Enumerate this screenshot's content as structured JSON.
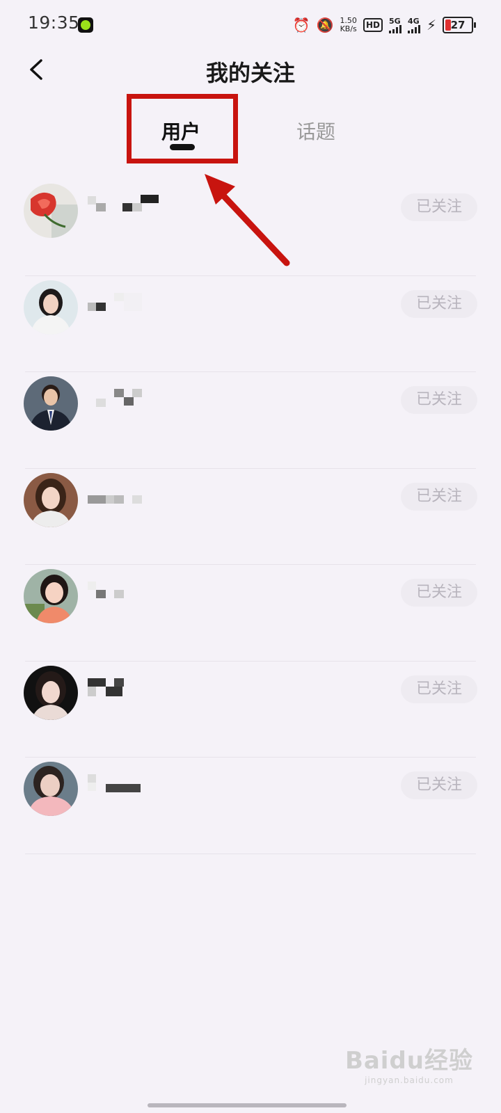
{
  "status_bar": {
    "time": "19:35",
    "net_speed_value": "1.50",
    "net_speed_unit": "KB/s",
    "hd_label": "HD",
    "sim1_label": "5G",
    "sim2_label": "4G",
    "battery": "27"
  },
  "header": {
    "title": "我的关注"
  },
  "tabs": [
    {
      "label": "用户",
      "active": true
    },
    {
      "label": "话题",
      "active": false
    }
  ],
  "users": [
    {
      "name": "",
      "follow_label": "已关注",
      "avatar": "rose-photo"
    },
    {
      "name": "",
      "follow_label": "已关注",
      "avatar": "woman-white-shirt"
    },
    {
      "name": "",
      "follow_label": "已关注",
      "avatar": "man-suit"
    },
    {
      "name": "",
      "follow_label": "已关注",
      "avatar": "woman-long-hair"
    },
    {
      "name": "",
      "follow_label": "已关注",
      "avatar": "woman-outdoor"
    },
    {
      "name": "",
      "follow_label": "已关注",
      "avatar": "woman-dark-bg"
    },
    {
      "name": "",
      "follow_label": "已关注",
      "avatar": "woman-pink-scarf"
    }
  ],
  "watermark": {
    "main": "Baidu经验",
    "sub": "jingyan.baidu.com"
  },
  "colors": {
    "background": "#f5f2f8",
    "annotation_red": "#c8140f",
    "follow_button_bg": "#eeebf1",
    "follow_button_text": "#b8b4bd",
    "active_tab": "#111111",
    "inactive_tab": "#999999"
  }
}
